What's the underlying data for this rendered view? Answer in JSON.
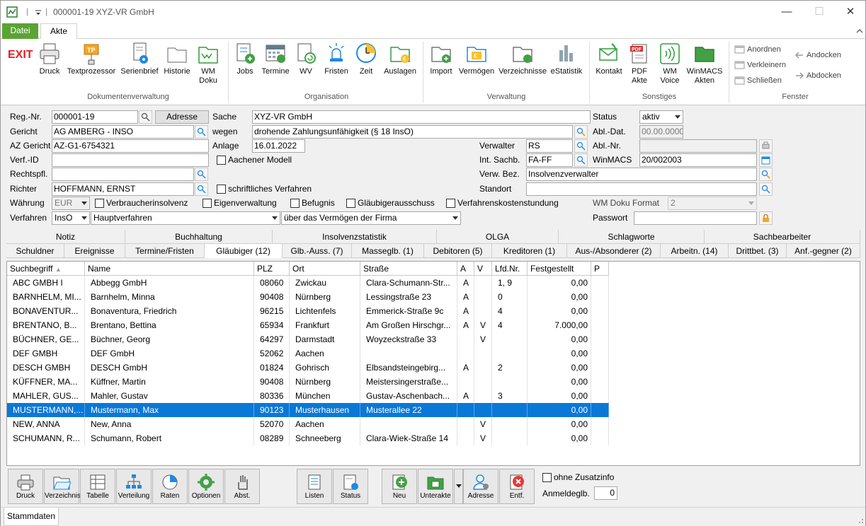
{
  "window": {
    "title": "000001-19 XYZ-VR GmbH"
  },
  "ribbon_tabs": [
    "Datei",
    "Akte"
  ],
  "ribbon": {
    "exit": "EXIT",
    "groups": {
      "dok": "Dokumentenverwaltung",
      "org": "Organisation",
      "verw": "Verwaltung",
      "sonst": "Sonstiges",
      "fenster": "Fenster"
    },
    "buttons": {
      "druck": "Druck",
      "textprozessor": "Textprozessor",
      "serienbrief": "Serienbrief",
      "historie": "Historie",
      "wmdoku1": "WM",
      "wmdoku2": "Doku",
      "jobs": "Jobs",
      "termine": "Termine",
      "wv": "WV",
      "fristen": "Fristen",
      "zeit": "Zeit",
      "auslagen": "Auslagen",
      "import": "Import",
      "vermoegen": "Vermögen",
      "verzeichnisse": "Verzeichnisse",
      "estatistik": "eStatistik",
      "kontakt": "Kontakt",
      "pdf1": "PDF",
      "pdf2": "Akte",
      "wmvoice1": "WM",
      "wmvoice2": "Voice",
      "winmacs1": "WinMACS",
      "winmacs2": "Akten",
      "anordnen": "Anordnen",
      "verkleinern": "Verkleinern",
      "schliessen": "Schließen",
      "andocken": "Andocken",
      "abdocken": "Abdocken"
    }
  },
  "form": {
    "regnr_label": "Reg.-Nr.",
    "regnr": "000001-19",
    "adresse_btn": "Adresse",
    "sache_label": "Sache",
    "sache": "XYZ-VR GmbH",
    "status_label": "Status",
    "status": "aktiv",
    "gericht_label": "Gericht",
    "gericht": "AG AMBERG - INSO",
    "wegen_label": "wegen",
    "wegen": "drohende Zahlungsunfähigkeit (§ 18 InsO)",
    "abldat_label": "Abl.-Dat.",
    "abldat": "00.00.0000",
    "azgericht_label": "AZ Gericht",
    "azgericht": "AZ-G1-6754321",
    "anlage_label": "Anlage",
    "anlage": "16.01.2022",
    "verwalter_label": "Verwalter",
    "verwalter": "RS",
    "ablnr_label": "Abl.-Nr.",
    "ablnr": "",
    "verfid_label": "Verf.-ID",
    "verfid": "",
    "aachener": "Aachener Modell",
    "intsachb_label": "Int. Sachb.",
    "intsachb": "FA-FF",
    "winmacs_label": "WinMACS",
    "winmacs": "20/002003",
    "rechtspfl_label": "Rechtspfl.",
    "rechtspfl": "",
    "verwbez_label": "Verw. Bez.",
    "verwbez": "Insolvenzverwalter",
    "richter_label": "Richter",
    "richter": "HOFFMANN, ERNST",
    "schriftlich": "schriftliches Verfahren",
    "standort_label": "Standort",
    "standort": "",
    "waehrung_label": "Währung",
    "waehrung": "EUR",
    "verbraucher": "Verbraucherinsolvenz",
    "eigenverwaltung": "Eigenverwaltung",
    "befugnis": "Befugnis",
    "glaeubigerausschuss": "Gläubigerausschuss",
    "verfahrenskosten": "Verfahrenskostenstundung",
    "wmdokuformat_label": "WM Doku Format",
    "wmdokuformat": "2",
    "verfahren_label": "Verfahren",
    "verfahren": "InsO",
    "hauptverfahren": "Hauptverfahren",
    "vermoegen_firma": "über das Vermögen der Firma",
    "passwort_label": "Passwort",
    "passwort": ""
  },
  "tabs_row1": [
    "Notiz",
    "Buchhaltung",
    "Insolvenzstatistik",
    "OLGA",
    "Schlagworte",
    "Sachbearbeiter"
  ],
  "tabs_row2": [
    "Schuldner",
    "Ereignisse",
    "Termine/Fristen",
    "Gläubiger (12)",
    "Glb.-Auss. (7)",
    "Masseglb. (1)",
    "Debitoren (5)",
    "Kreditoren (1)",
    "Aus-/Absonderer (2)",
    "Arbeitn. (14)",
    "Drittbet. (3)",
    "Anf.-gegner (2)"
  ],
  "table": {
    "columns": [
      "Suchbegriff",
      "Name",
      "PLZ",
      "Ort",
      "Straße",
      "A",
      "V",
      "Lfd.Nr.",
      "Festgestellt",
      "P"
    ],
    "rows": [
      [
        "ABC GMBH I",
        "Abbegg GmbH",
        "08060",
        "Zwickau",
        "Clara-Schumann-Str...",
        "A",
        "",
        "1, 9",
        "0,00",
        ""
      ],
      [
        "BARNHELM, MI...",
        "Barnhelm, Minna",
        "90408",
        "Nürnberg",
        "Lessingstraße 23",
        "A",
        "",
        "0",
        "0,00",
        ""
      ],
      [
        "BONAVENTUR...",
        "Bonaventura, Friedrich",
        "96215",
        "Lichtenfels",
        "Emmerick-Straße 9c",
        "A",
        "",
        "4",
        "0,00",
        ""
      ],
      [
        "BRENTANO, B...",
        "Brentano, Bettina",
        "65934",
        "Frankfurt",
        "Am Großen Hirschgr...",
        "A",
        "V",
        "4",
        "7.000,00",
        ""
      ],
      [
        "BÜCHNER, GE...",
        "Büchner, Georg",
        "64297",
        "Darmstadt",
        "Woyzeckstraße 33",
        "",
        "V",
        "",
        "0,00",
        ""
      ],
      [
        "DEF GMBH",
        "DEF GmbH",
        "52062",
        "Aachen",
        "",
        "",
        "",
        "",
        "0,00",
        ""
      ],
      [
        "DESCH GMBH",
        "DESCH GmbH",
        "01824",
        "Gohrisch",
        "Elbsandsteingebirg...",
        "A",
        "",
        "2",
        "0,00",
        ""
      ],
      [
        "KÜFFNER, MA...",
        "Küffner, Martin",
        "90408",
        "Nürnberg",
        "Meistersingerstraße...",
        "",
        "",
        "",
        "0,00",
        ""
      ],
      [
        "MAHLER, GUS...",
        "Mahler, Gustav",
        "80336",
        "München",
        "Gustav-Aschenbach...",
        "A",
        "",
        "3",
        "0,00",
        ""
      ],
      [
        "MUSTERMANN,...",
        "Mustermann, Max",
        "90123",
        "Musterhausen",
        "Musterallee 22",
        "",
        "",
        "",
        "0,00",
        ""
      ],
      [
        "NEW, ANNA",
        "New, Anna",
        "52070",
        "Aachen",
        "",
        "",
        "V",
        "",
        "0,00",
        ""
      ],
      [
        "SCHUMANN, R...",
        "Schumann, Robert",
        "08289",
        "Schneeberg",
        "Clara-Wiek-Straße 14",
        "",
        "V",
        "",
        "0,00",
        ""
      ]
    ]
  },
  "bottom": {
    "druck": "Druck",
    "verzeichnis": "Verzeichnis",
    "tabelle": "Tabelle",
    "verteilung": "Verteilung",
    "raten": "Raten",
    "optionen": "Optionen",
    "abst": "Abst.",
    "listen": "Listen",
    "status": "Status",
    "neu": "Neu",
    "unterakte": "Unterakte",
    "adresse": "Adresse",
    "entf": "Entf.",
    "ohne_zusatz": "ohne Zusatzinfo",
    "anmeldeglb_label": "Anmeldeglb.",
    "anmeldeglb": "0"
  },
  "statusbar": {
    "tab": "Stammdaten"
  }
}
